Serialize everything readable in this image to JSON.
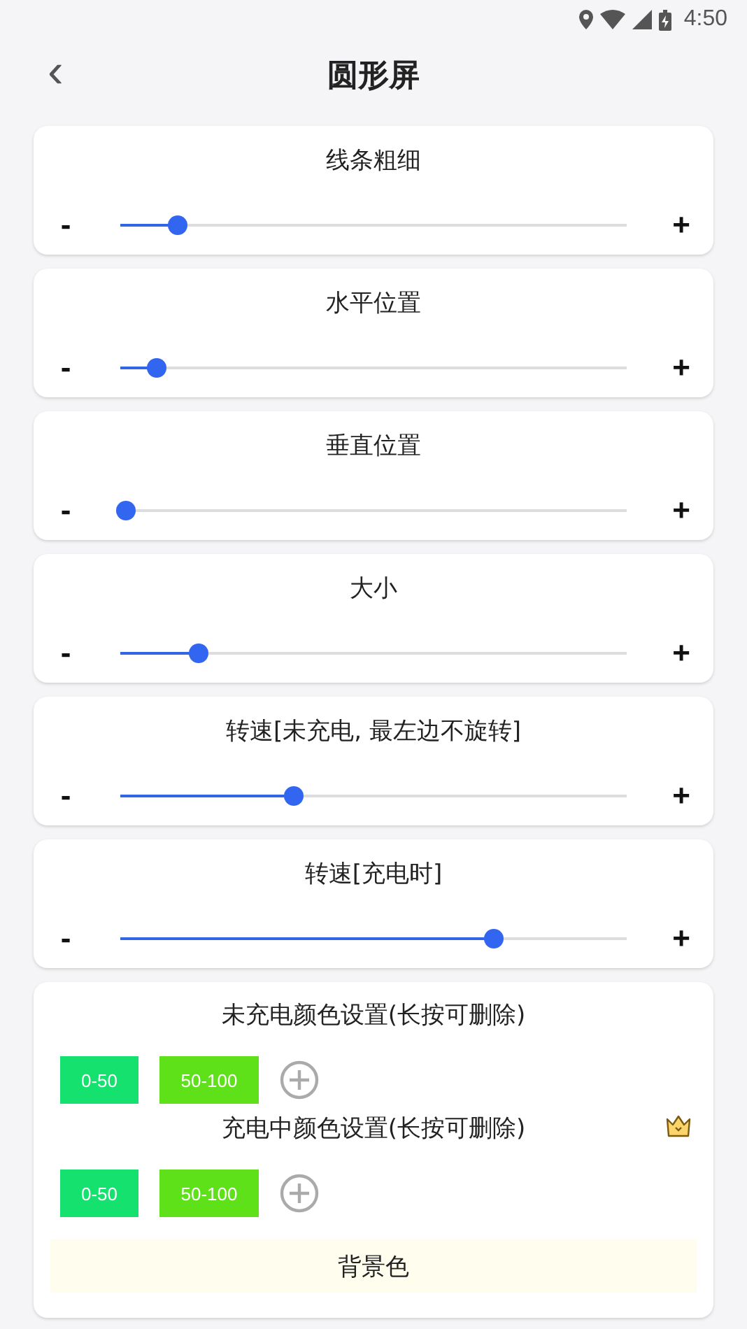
{
  "status_bar": {
    "time": "4:50"
  },
  "header": {
    "back": "‹",
    "title": "圆形屏"
  },
  "sliders": [
    {
      "title": "线条粗细",
      "minus": "-",
      "plus": "+",
      "level": 0.11
    },
    {
      "title": "水平位置",
      "minus": "-",
      "plus": "+",
      "level": 0.07
    },
    {
      "title": "垂直位置",
      "minus": "-",
      "plus": "+",
      "level": 0.01
    },
    {
      "title": "大小",
      "minus": "-",
      "plus": "+",
      "level": 0.15
    },
    {
      "title": "转速[未充电, 最左边不旋转]",
      "minus": "-",
      "plus": "+",
      "level": 0.33
    },
    {
      "title": "转速[充电时]",
      "minus": "-",
      "plus": "+",
      "level": 0.71
    }
  ],
  "color_groups": [
    {
      "title": "未充电颜色设置(长按可删除)",
      "premium": false,
      "ranges": [
        {
          "label": "0-50",
          "color": "#14e16e"
        },
        {
          "label": "50-100",
          "color": "#5ee119"
        }
      ]
    },
    {
      "title": "充电中颜色设置(长按可删除)",
      "premium": true,
      "ranges": [
        {
          "label": "0-50",
          "color": "#14e16e"
        },
        {
          "label": "50-100",
          "color": "#5ee119"
        }
      ]
    }
  ],
  "background_button": "背景色"
}
